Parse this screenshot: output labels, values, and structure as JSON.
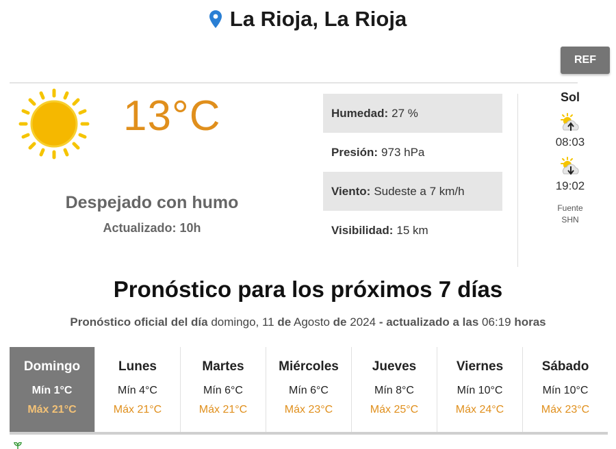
{
  "location": {
    "title": "La Rioja, La Rioja",
    "icon": "map-pin-icon"
  },
  "ref_button": {
    "label": "REF"
  },
  "current": {
    "temperature": "13°C",
    "condition": "Despejado con humo",
    "updated": "Actualizado: 10h",
    "icon": "sun-icon"
  },
  "details": [
    {
      "label": "Humedad:",
      "value": "27 %"
    },
    {
      "label": "Presión:",
      "value": "973 hPa"
    },
    {
      "label": "Viento:",
      "value": "Sudeste a 7 km/h"
    },
    {
      "label": "Visibilidad:",
      "value": "15 km"
    }
  ],
  "sol": {
    "title": "Sol",
    "sunrise": "08:03",
    "sunset": "19:02",
    "fuente_label": "Fuente",
    "fuente_value": "SHN"
  },
  "forecast": {
    "title": "Pronóstico para los próximos 7 días",
    "sub_prefix": "Pronóstico oficial del día",
    "sub_weekday": "domingo, 11",
    "sub_de1": "de",
    "sub_month": "Agosto",
    "sub_de2": "de",
    "sub_year": "2024",
    "sub_actualizado": "- actualizado a las",
    "sub_time": "06:19",
    "sub_horas": "horas",
    "days": [
      {
        "name": "Domingo",
        "min": "Mín 1°C",
        "max": "Máx 21°C"
      },
      {
        "name": "Lunes",
        "min": "Mín 4°C",
        "max": "Máx 21°C"
      },
      {
        "name": "Martes",
        "min": "Mín 6°C",
        "max": "Máx 21°C"
      },
      {
        "name": "Miércoles",
        "min": "Mín 6°C",
        "max": "Máx 23°C"
      },
      {
        "name": "Jueves",
        "min": "Mín 8°C",
        "max": "Máx 25°C"
      },
      {
        "name": "Viernes",
        "min": "Mín 10°C",
        "max": "Máx 24°C"
      },
      {
        "name": "Sábado",
        "min": "Mín 10°C",
        "max": "Máx 23°C"
      }
    ]
  },
  "colors": {
    "accent": "#e08f1c",
    "pin": "#2a7fd4",
    "active_day": "#7a7a7a"
  }
}
